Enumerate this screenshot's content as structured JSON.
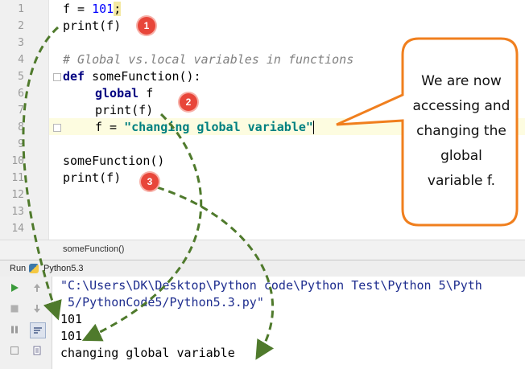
{
  "editor": {
    "line_numbers": [
      "1",
      "2",
      "3",
      "4",
      "5",
      "6",
      "7",
      "8",
      "9",
      "10",
      "11",
      "12",
      "13",
      "14"
    ],
    "code": {
      "l1_a": "f = ",
      "l1_num": "101",
      "l1_semi": ";",
      "l2": "print(f)",
      "l4": "# Global vs.local variables in functions",
      "l5_kw": "def",
      "l5_rest": " someFunction():",
      "l6_kw": "global",
      "l6_rest": " f",
      "l7": "print(f)",
      "l8_a": "f = ",
      "l8_str": "\"changing global variable\"",
      "l10": "someFunction()",
      "l11": "print(f)"
    },
    "breadcrumb": "someFunction()"
  },
  "run_panel": {
    "label": "Run",
    "config_name": "Python5.3",
    "output": [
      "\"C:\\Users\\DK\\Desktop\\Python code\\Python Test\\Python 5\\Pyth",
      " 5/PythonCode5/Python5.3.py\"",
      "101",
      "101",
      "changing global variable"
    ]
  },
  "annotations": {
    "badges": [
      "1",
      "2",
      "3"
    ],
    "callout_lines": [
      "We are now",
      "accessing and",
      "changing the",
      "global",
      "variable f."
    ],
    "callout_border_color": "#f07f1e",
    "arrow_color": "#4f7a2c",
    "badge_color": "#e8463a"
  },
  "icons": {
    "run": "play-icon",
    "stop": "stop-icon",
    "pause": "pause-icon",
    "up": "arrow-up-icon",
    "down": "arrow-down-icon",
    "wrap": "soft-wrap-icon",
    "print": "print-icon"
  }
}
